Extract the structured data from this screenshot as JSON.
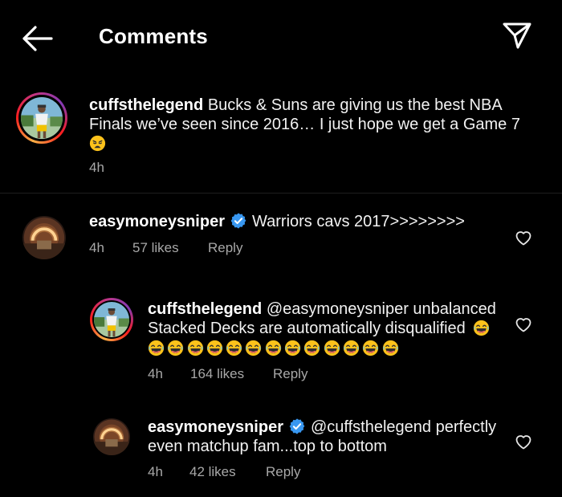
{
  "header": {
    "title": "Comments"
  },
  "caption": {
    "username": "cuffsthelegend",
    "text": "Bucks & Suns are giving us the best NBA Finals we’ve seen since 2016… I just hope we get a Game 7",
    "emoji": "😩",
    "time": "4h"
  },
  "comments": [
    {
      "username": "easymoneysniper",
      "verified": true,
      "text": "Warriors cavs 2017>>>>>>>>",
      "time": "4h",
      "likes": "57 likes",
      "reply_label": "Reply"
    },
    {
      "username": "cuffsthelegend",
      "verified": false,
      "text_line1": "@easymoneysniper unbalanced",
      "text_line2": "Stacked Decks are automatically disqualified",
      "emoji": "😂",
      "emoji_row_count": 13,
      "time": "4h",
      "likes": "164 likes",
      "reply_label": "Reply"
    },
    {
      "username": "easymoneysniper",
      "verified": true,
      "text_line1": "@cuffsthelegend perfectly",
      "text_line2": "even matchup fam...top to bottom",
      "time": "4h",
      "likes": "42 likes",
      "reply_label": "Reply"
    }
  ],
  "icons": {
    "back": "arrow-left-icon",
    "send": "paper-plane-icon",
    "like": "heart-outline-icon",
    "verified": "verified-badge-icon"
  },
  "colors": {
    "background": "#000000",
    "text": "#f5f5f5",
    "muted": "#a8a8a8",
    "verified": "#3897f0"
  }
}
